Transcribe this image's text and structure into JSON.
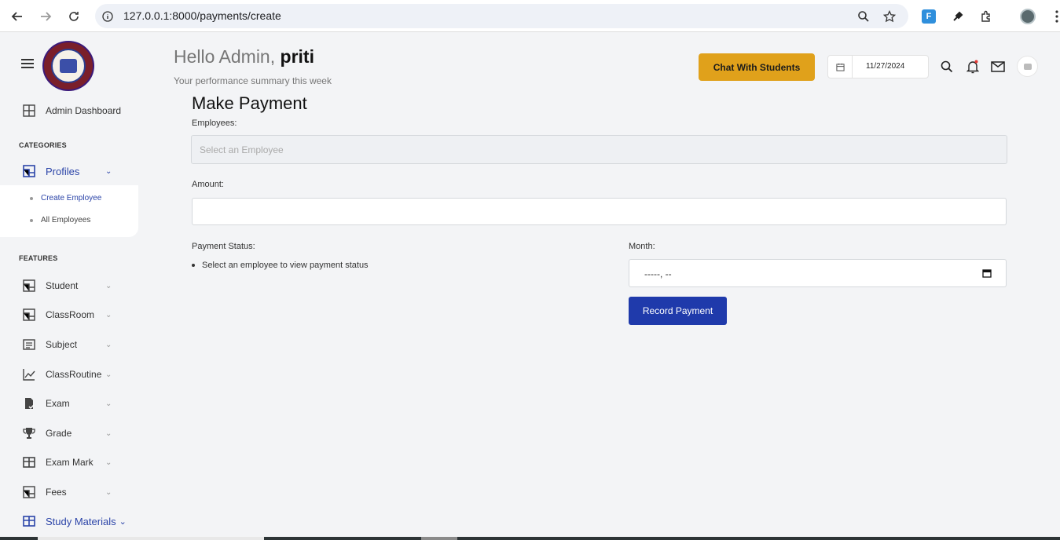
{
  "browser": {
    "url": "127.0.0.1:8000/payments/create",
    "back_icon": "arrow-left-icon",
    "forward_icon": "arrow-right-icon",
    "reload_icon": "reload-icon"
  },
  "sidebar": {
    "dashboard_label": "Admin Dashboard",
    "categories_label": "CATEGORIES",
    "profiles_label": "Profiles",
    "sub_items": [
      "Create Employee",
      "All Employees"
    ],
    "features_label": "FEATURES",
    "features": [
      "Student",
      "ClassRoom",
      "Subject",
      "ClassRoutine",
      "Exam",
      "Grade",
      "Exam Mark",
      "Fees",
      "Study Materials"
    ]
  },
  "header": {
    "greeting_prefix": "Hello Admin, ",
    "user_name": "priti",
    "subtitle": "Your performance summary this week",
    "chat_button": "Chat With Students",
    "date": "11/27/2024"
  },
  "form": {
    "title": "Make Payment",
    "employees_label": "Employees:",
    "employees_placeholder": "Select an Employee",
    "amount_label": "Amount:",
    "amount_value": "",
    "payment_status_label": "Payment Status:",
    "payment_status_item": "Select an employee to view payment status",
    "month_label": "Month:",
    "month_value": "-----, --",
    "submit_label": "Record Payment"
  },
  "colors": {
    "accent": "#1f3aab",
    "chat_button": "#e0a11b",
    "active_nav": "#2b44a8"
  }
}
